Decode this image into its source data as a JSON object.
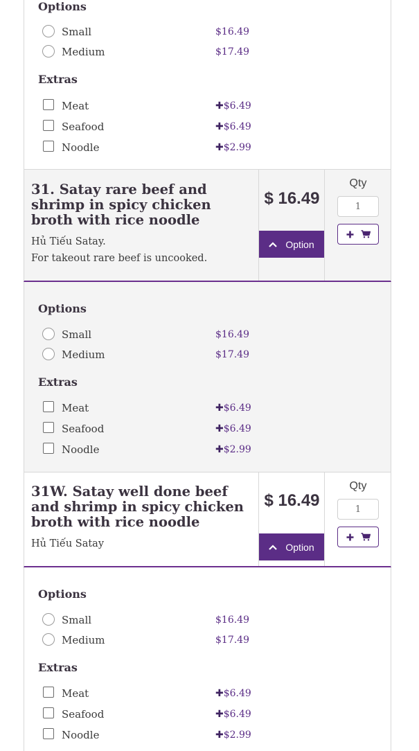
{
  "labels": {
    "options": "Options",
    "extras": "Extras",
    "option_button": "Option",
    "qty": "Qty"
  },
  "sizes": [
    {
      "label": "Small",
      "price": "$16.49"
    },
    {
      "label": "Medium",
      "price": "$17.49"
    }
  ],
  "extras": [
    {
      "label": "Meat",
      "price": "$6.49"
    },
    {
      "label": "Seafood",
      "price": "$6.49"
    },
    {
      "label": "Noodle",
      "price": "$2.99"
    }
  ],
  "items": [
    {
      "title": "31. Satay rare beef and shrimp in spicy chicken broth with rice noodle",
      "desc1": "Hủ Tiếu Satay.",
      "desc2": "For takeout rare beef is uncooked.",
      "price": "$ 16.49",
      "qty": "1"
    },
    {
      "title": "31W. Satay well done beef and shrimp in spicy chicken broth with rice noodle",
      "desc1": "Hủ Tiếu Satay",
      "price": "$ 16.49",
      "qty": "1"
    }
  ],
  "colors": {
    "accent": "#5b2d86",
    "heading": "#3b3340",
    "shaded_bg": "#f4f4f4"
  },
  "icons": {
    "option_toggle": "chevron-up-icon",
    "add_plus": "plus-icon",
    "cart": "cart-icon"
  }
}
